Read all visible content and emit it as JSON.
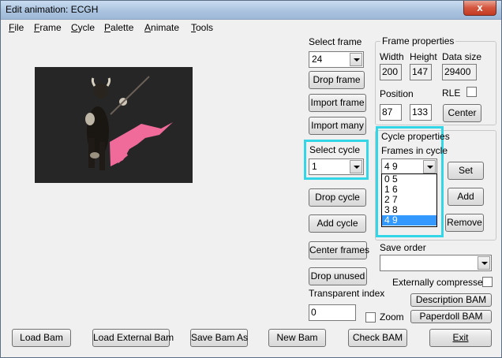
{
  "window": {
    "title": "Edit animation: ECGH",
    "close_label": "x"
  },
  "menu": [
    {
      "key": "F",
      "rest": "ile"
    },
    {
      "key": "F",
      "rest": "rame"
    },
    {
      "key": "C",
      "rest": "ycle"
    },
    {
      "key": "P",
      "rest": "alette"
    },
    {
      "key": "A",
      "rest": "nimate"
    },
    {
      "key": "T",
      "rest": "ools"
    }
  ],
  "select_frame": {
    "label": "Select frame",
    "value": "24"
  },
  "buttons": {
    "drop_frame": "Drop frame",
    "import_frame": "Import frame",
    "import_many": "Import many",
    "drop_cycle": "Drop cycle",
    "add_cycle": "Add cycle",
    "center_frames": "Center frames",
    "drop_unused": "Drop unused",
    "center": "Center",
    "set": "Set",
    "add": "Add",
    "remove": "Remove",
    "description_bam": "Description BAM",
    "paperdoll_bam": "Paperdoll BAM",
    "load_bam": "Load Bam",
    "load_external_bam": "Load External Bam",
    "save_bam_as": "Save Bam As",
    "new_bam": "New Bam",
    "check_bam": "Check BAM",
    "exit": "Exit"
  },
  "select_cycle": {
    "label": "Select cycle",
    "value": "1"
  },
  "frame_properties": {
    "title": "Frame properties",
    "width_label": "Width",
    "width": "200",
    "height_label": "Height",
    "height": "147",
    "data_size_label": "Data size",
    "data_size": "29400",
    "rle_label": "RLE",
    "position_label": "Position",
    "pos_x": "87",
    "pos_y": "133"
  },
  "cycle_properties": {
    "title": "Cycle properties",
    "frames_label": "Frames in cycle",
    "frames_value": "4 9",
    "options": [
      "0 5",
      "1 6",
      "2 7",
      "3 8",
      "4 9"
    ],
    "selected_index": 4
  },
  "save_order": {
    "label": "Save order",
    "value": ""
  },
  "externally_compressed_label": "Externally compressed",
  "transparent_index": {
    "label": "Transparent index",
    "value": "0"
  },
  "zoom_label": "Zoom"
}
